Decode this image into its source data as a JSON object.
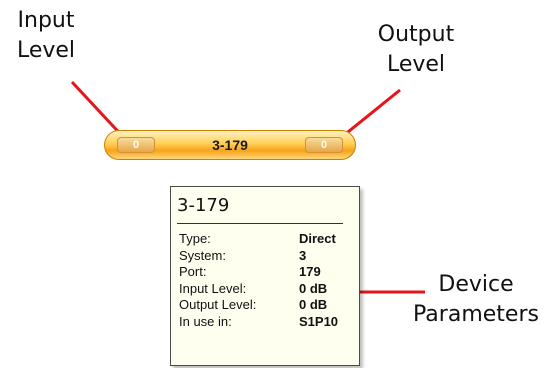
{
  "callouts": {
    "input": [
      "Input",
      "Level"
    ],
    "output": [
      "Output",
      "Level"
    ],
    "device": [
      "Device",
      "Parameters"
    ]
  },
  "device_bar": {
    "name": "3-179",
    "input_level": "0",
    "output_level": "0"
  },
  "tooltip": {
    "title": "3-179",
    "rows": [
      {
        "label": "Type:",
        "value": "Direct"
      },
      {
        "label": "System:",
        "value": "3"
      },
      {
        "label": "Port:",
        "value": "179"
      },
      {
        "label": "Input Level:",
        "value": "0 dB"
      },
      {
        "label": "Output Level:",
        "value": "0 dB"
      },
      {
        "label": "In use in:",
        "value": "S1P10"
      }
    ]
  },
  "colors": {
    "arrow": "#e8141b",
    "bar_orange": "#f7a21b",
    "tooltip_bg": "#fffff0"
  }
}
